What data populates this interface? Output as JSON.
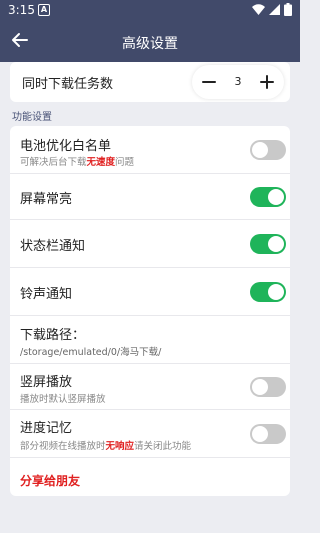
{
  "status_bar": {
    "time": "3:15",
    "notification_badge": "A",
    "icons": [
      "wifi-icon",
      "signal-icon",
      "battery-icon"
    ]
  },
  "header": {
    "title": "高级设置",
    "back_icon": "arrow-left-icon",
    "bg_color": "#414a6a"
  },
  "concurrent": {
    "label": "同时下载任务数",
    "value": "3"
  },
  "section": {
    "label": "功能设置"
  },
  "settings": {
    "battery": {
      "title": "电池优化白名单",
      "sub_pre": "可解决后台下载",
      "sub_hl": "无速度",
      "sub_post": "问题",
      "enabled": false
    },
    "screen_on": {
      "title": "屏幕常亮",
      "enabled": true
    },
    "statusbar_notify": {
      "title": "状态栏通知",
      "enabled": true
    },
    "ringtone_notify": {
      "title": "铃声通知",
      "enabled": true
    },
    "download_path": {
      "title": "下载路径：",
      "value": "/storage/emulated/0/海马下载/"
    },
    "portrait": {
      "title": "竖屏播放",
      "sub": "播放时默认竖屏播放",
      "enabled": false
    },
    "progress_memory": {
      "title": "进度记忆",
      "sub_pre": "部分视频在线播放时",
      "sub_hl": "无响应",
      "sub_post": "请关闭此功能",
      "enabled": false
    },
    "share": {
      "label": "分享给朋友"
    }
  },
  "colors": {
    "toggle_on": "#1fb45a",
    "toggle_off": "#c9c9c9",
    "highlight": "#e02020",
    "background": "#ecedf2"
  }
}
